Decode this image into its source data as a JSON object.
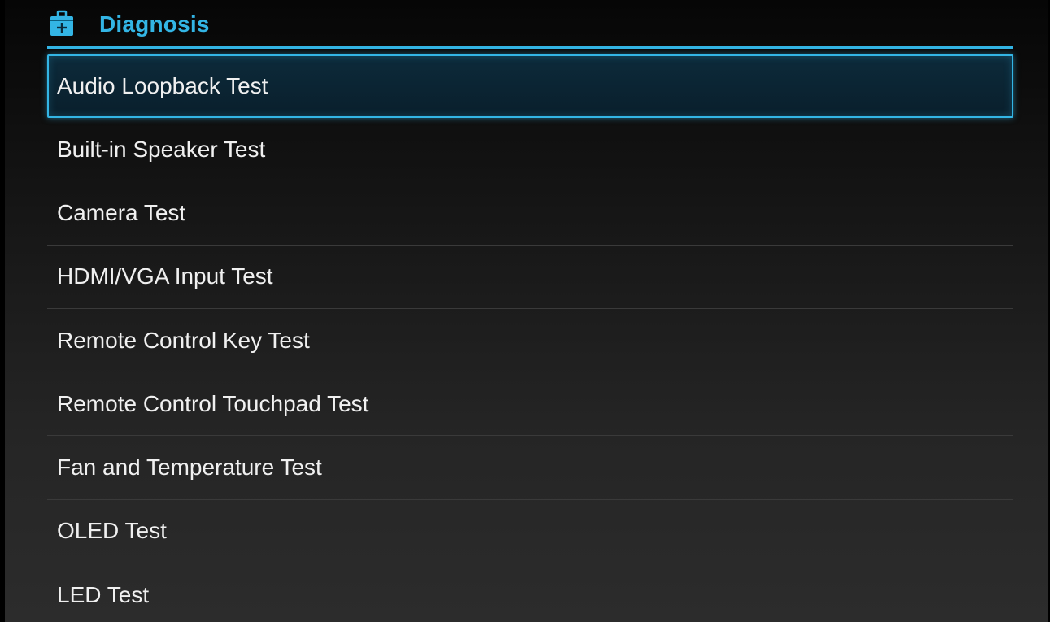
{
  "header": {
    "title": "Diagnosis",
    "icon": "toolbox-icon",
    "accent_color": "#33b5e5"
  },
  "list": {
    "focused_index": 0,
    "items": [
      {
        "label": "Audio Loopback Test"
      },
      {
        "label": "Built-in Speaker Test"
      },
      {
        "label": "Camera Test"
      },
      {
        "label": "HDMI/VGA Input Test"
      },
      {
        "label": "Remote Control Key Test"
      },
      {
        "label": "Remote Control Touchpad Test"
      },
      {
        "label": "Fan and Temperature Test"
      },
      {
        "label": "OLED Test"
      },
      {
        "label": "LED Test"
      }
    ]
  }
}
